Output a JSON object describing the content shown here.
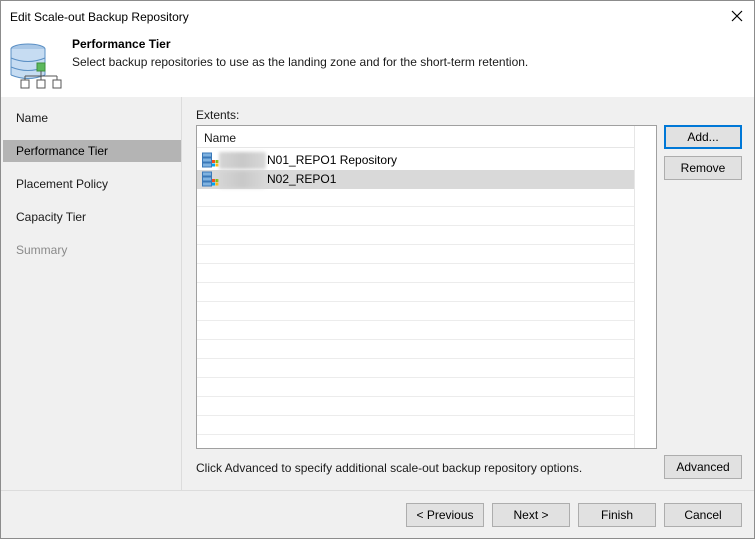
{
  "window": {
    "title": "Edit Scale-out Backup Repository"
  },
  "header": {
    "title": "Performance Tier",
    "description": "Select backup repositories to use as the landing zone and for the short-term retention.",
    "icon": "database-tree-icon"
  },
  "sidebar": {
    "items": [
      {
        "label": "Name",
        "state": "normal"
      },
      {
        "label": "Performance Tier",
        "state": "active"
      },
      {
        "label": "Placement Policy",
        "state": "normal"
      },
      {
        "label": "Capacity Tier",
        "state": "normal"
      },
      {
        "label": "Summary",
        "state": "disabled"
      }
    ]
  },
  "extents": {
    "label": "Extents:",
    "column_header": "Name",
    "rows": [
      {
        "name": "N01_REPO1 Repository",
        "icon": "windows-repository-icon",
        "selected": false
      },
      {
        "name": "N02_REPO1",
        "icon": "windows-repository-icon",
        "selected": true
      }
    ]
  },
  "buttons": {
    "add": "Add...",
    "remove": "Remove",
    "advanced": "Advanced",
    "previous": "< Previous",
    "next": "Next >",
    "finish": "Finish",
    "cancel": "Cancel"
  },
  "hint": "Click Advanced to specify additional scale-out backup repository options.",
  "colors": {
    "sidebar_active": "#b4b4b4",
    "selected_row": "#d9d9d9",
    "focus_border": "#0078d7"
  }
}
